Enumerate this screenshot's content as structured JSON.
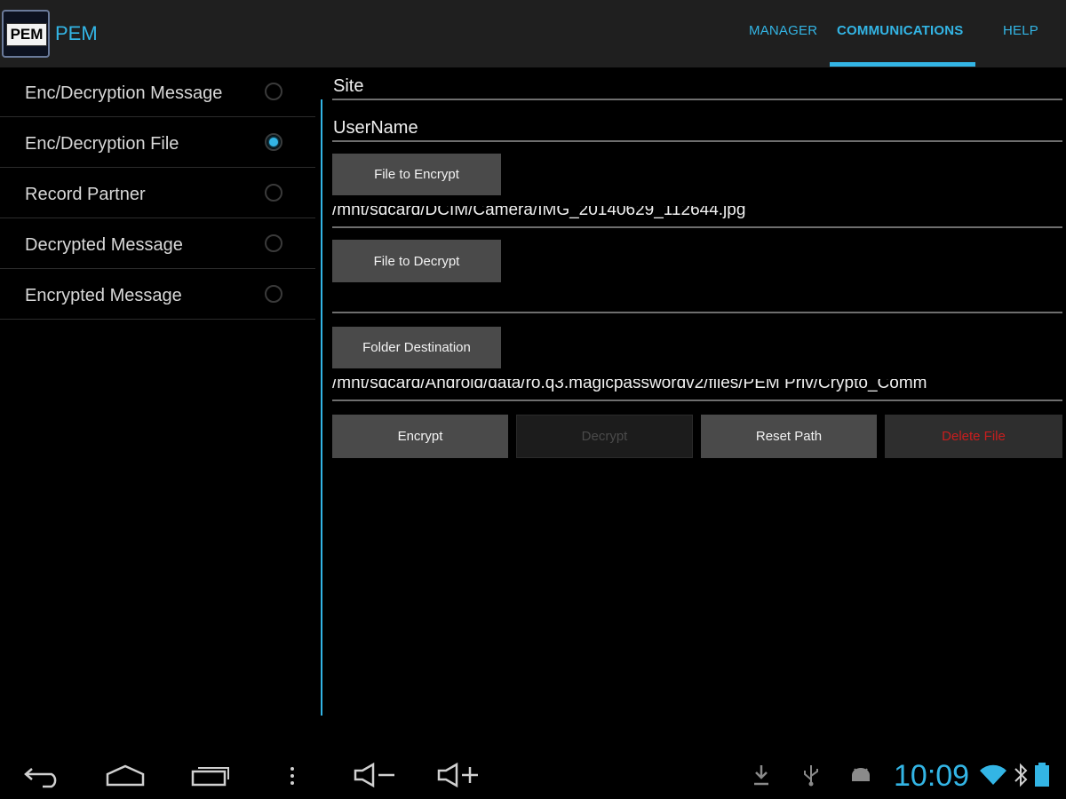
{
  "app": {
    "icon_text": "PEM",
    "title": "PEM"
  },
  "tabs": [
    {
      "label": "MANAGER",
      "selected": false
    },
    {
      "label": "COMMUNICATIONS",
      "selected": true
    },
    {
      "label": "HELP",
      "selected": false
    }
  ],
  "sidebar": {
    "items": [
      {
        "label": "Enc/Decryption Message",
        "checked": false
      },
      {
        "label": "Enc/Decryption File",
        "checked": true
      },
      {
        "label": "Record Partner",
        "checked": false
      },
      {
        "label": "Decrypted Message",
        "checked": false
      },
      {
        "label": "Encrypted Message",
        "checked": false
      }
    ]
  },
  "form": {
    "site_label": "Site",
    "username_label": "UserName",
    "file_to_encrypt_button": "File to Encrypt",
    "encrypt_path": "/mnt/sdcard/DCIM/Camera/IMG_20140629_112644.jpg",
    "file_to_decrypt_button": "File to Decrypt",
    "decrypt_path": "",
    "folder_destination_button": "Folder Destination",
    "destination_path": "/mnt/sdcard/Android/data/ro.q3.magicpasswordv2/files/PEM Priv/Crypto_Comm"
  },
  "actions": {
    "encrypt": "Encrypt",
    "decrypt": "Decrypt",
    "reset_path": "Reset Path",
    "delete_file": "Delete File"
  },
  "system_bar": {
    "clock": "10:09",
    "icons": [
      "back-icon",
      "home-icon",
      "recent-apps-icon",
      "menu-icon",
      "volume-down-icon",
      "volume-up-icon",
      "download-icon",
      "usb-icon",
      "android-debug-icon",
      "wifi-icon",
      "bluetooth-icon",
      "battery-icon"
    ]
  },
  "colors": {
    "accent": "#33b5e5",
    "danger": "#c81e1e",
    "action_bar": "#1f1f1f",
    "button": "#4a4a4a"
  }
}
